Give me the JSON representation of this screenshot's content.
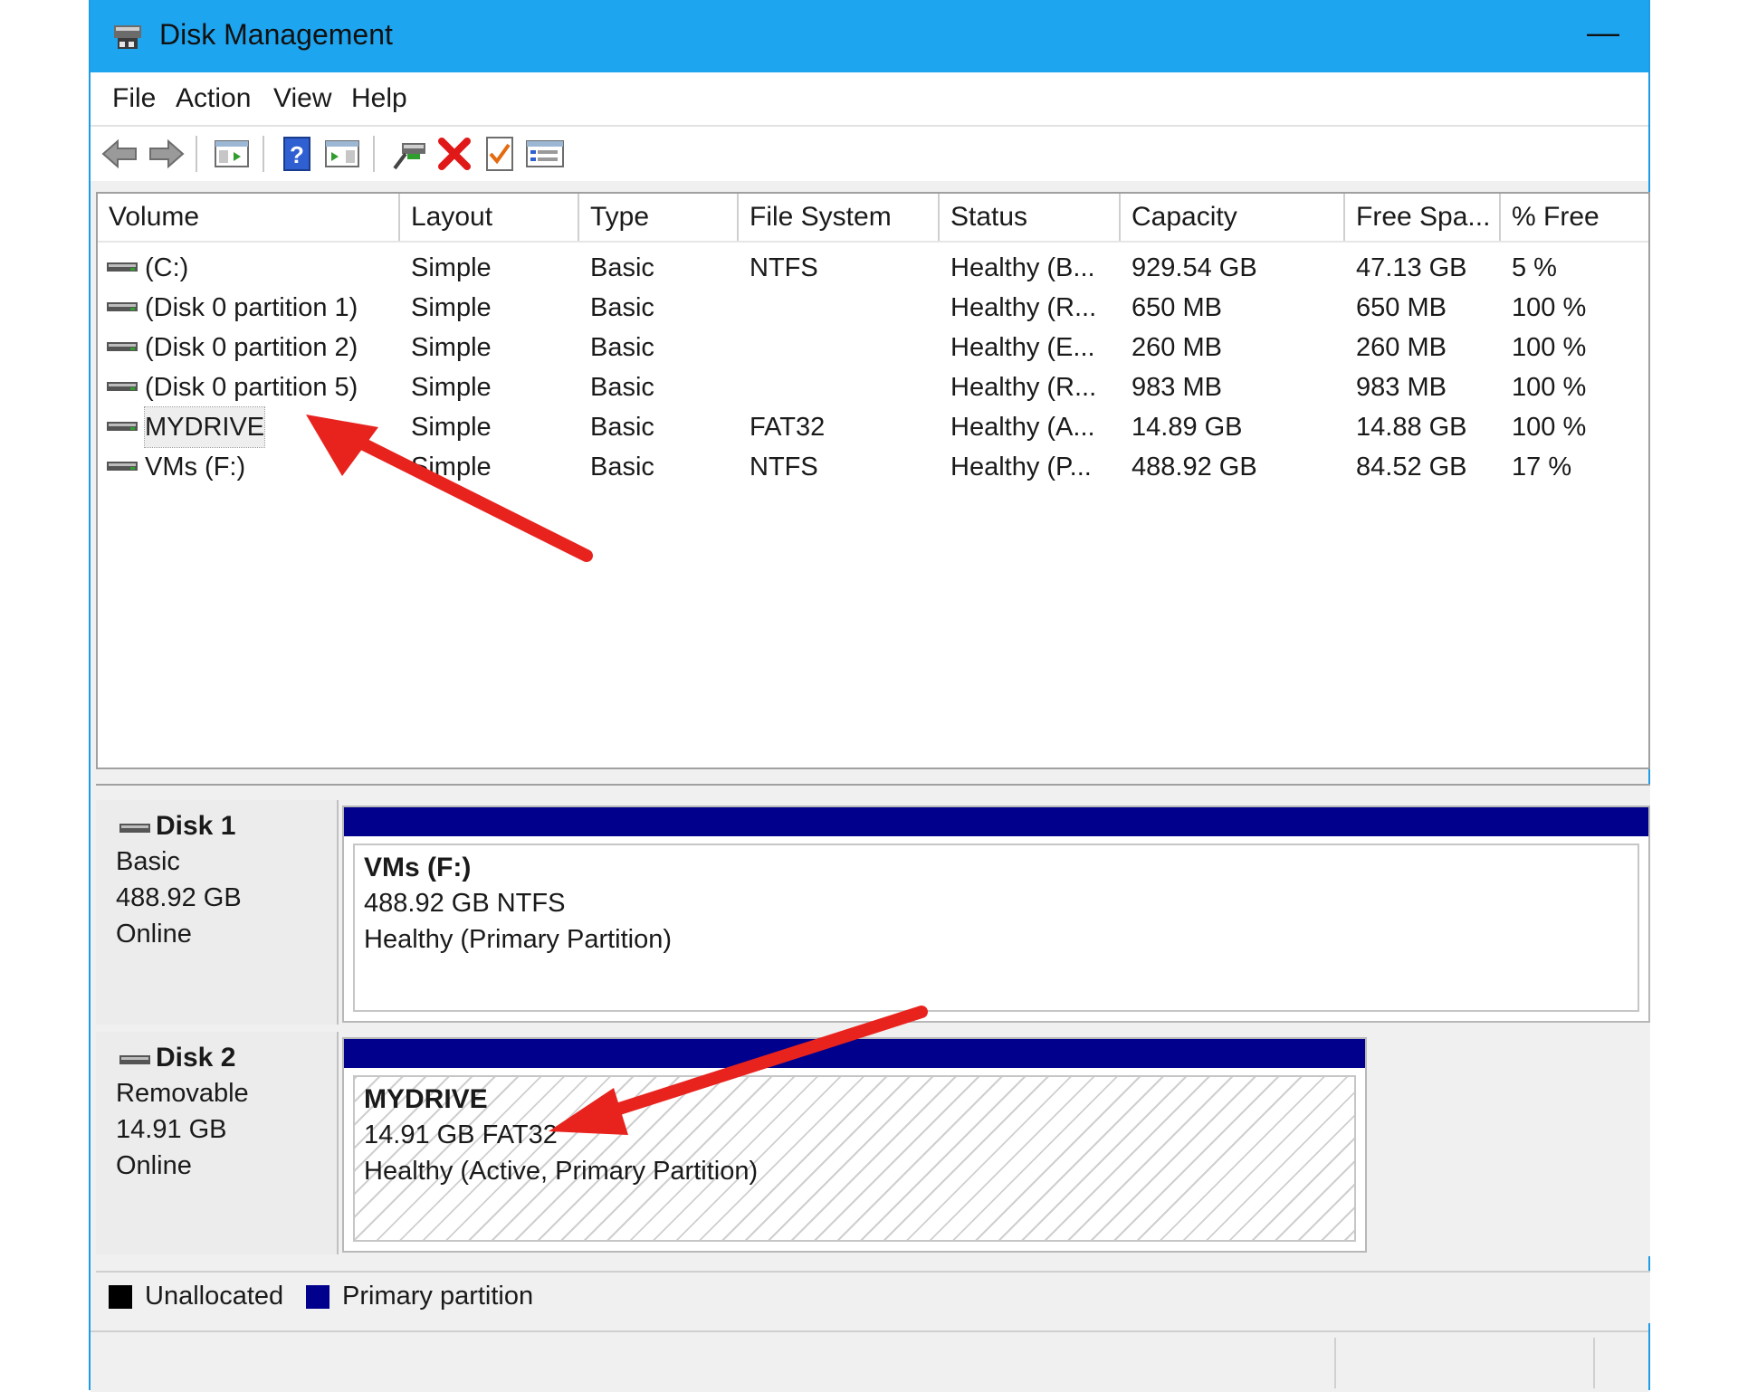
{
  "window": {
    "title": "Disk Management",
    "minimize_glyph": "—"
  },
  "menu": [
    "File",
    "Action",
    "View",
    "Help"
  ],
  "toolbar_icons": [
    "back-icon",
    "forward-icon",
    "console-tree-icon",
    "help-icon",
    "action-pane-icon",
    "connect-icon",
    "delete-icon",
    "properties-icon",
    "list-view-icon"
  ],
  "volume_table": {
    "columns": [
      "Volume",
      "Layout",
      "Type",
      "File System",
      "Status",
      "Capacity",
      "Free Spa...",
      "% Free"
    ],
    "rows": [
      {
        "volume": "(C:)",
        "layout": "Simple",
        "type": "Basic",
        "fs": "NTFS",
        "status": "Healthy (B...",
        "capacity": "929.54 GB",
        "free": "47.13 GB",
        "pct": "5 %"
      },
      {
        "volume": "(Disk 0 partition 1)",
        "layout": "Simple",
        "type": "Basic",
        "fs": "",
        "status": "Healthy (R...",
        "capacity": "650 MB",
        "free": "650 MB",
        "pct": "100 %"
      },
      {
        "volume": "(Disk 0 partition 2)",
        "layout": "Simple",
        "type": "Basic",
        "fs": "",
        "status": "Healthy (E...",
        "capacity": "260 MB",
        "free": "260 MB",
        "pct": "100 %"
      },
      {
        "volume": "(Disk 0 partition 5)",
        "layout": "Simple",
        "type": "Basic",
        "fs": "",
        "status": "Healthy (R...",
        "capacity": "983 MB",
        "free": "983 MB",
        "pct": "100 %"
      },
      {
        "volume": "MYDRIVE",
        "layout": "Simple",
        "type": "Basic",
        "fs": "FAT32",
        "status": "Healthy (A...",
        "capacity": "14.89 GB",
        "free": "14.88 GB",
        "pct": "100 %"
      },
      {
        "volume": "VMs (F:)",
        "layout": "Simple",
        "type": "Basic",
        "fs": "NTFS",
        "status": "Healthy (P...",
        "capacity": "488.92 GB",
        "free": "84.52 GB",
        "pct": "17 %"
      }
    ]
  },
  "disks": [
    {
      "name": "Disk 1",
      "kind": "Basic",
      "size": "488.92 GB",
      "state": "Online",
      "partition": {
        "label": "VMs  (F:)",
        "detail": "488.92 GB NTFS",
        "status": "Healthy (Primary Partition)"
      }
    },
    {
      "name": "Disk 2",
      "kind": "Removable",
      "size": "14.91 GB",
      "state": "Online",
      "partition": {
        "label": "MYDRIVE",
        "detail": "14.91 GB FAT32",
        "status": "Healthy (Active, Primary Partition)"
      }
    }
  ],
  "legend": {
    "unallocated": "Unallocated",
    "primary": "Primary partition",
    "unallocated_color": "#000000",
    "primary_color": "#00008c"
  },
  "colors": {
    "titlebar": "#1ea5f0",
    "partition_bar": "#00008c",
    "annotation_arrow": "#e8231e"
  }
}
